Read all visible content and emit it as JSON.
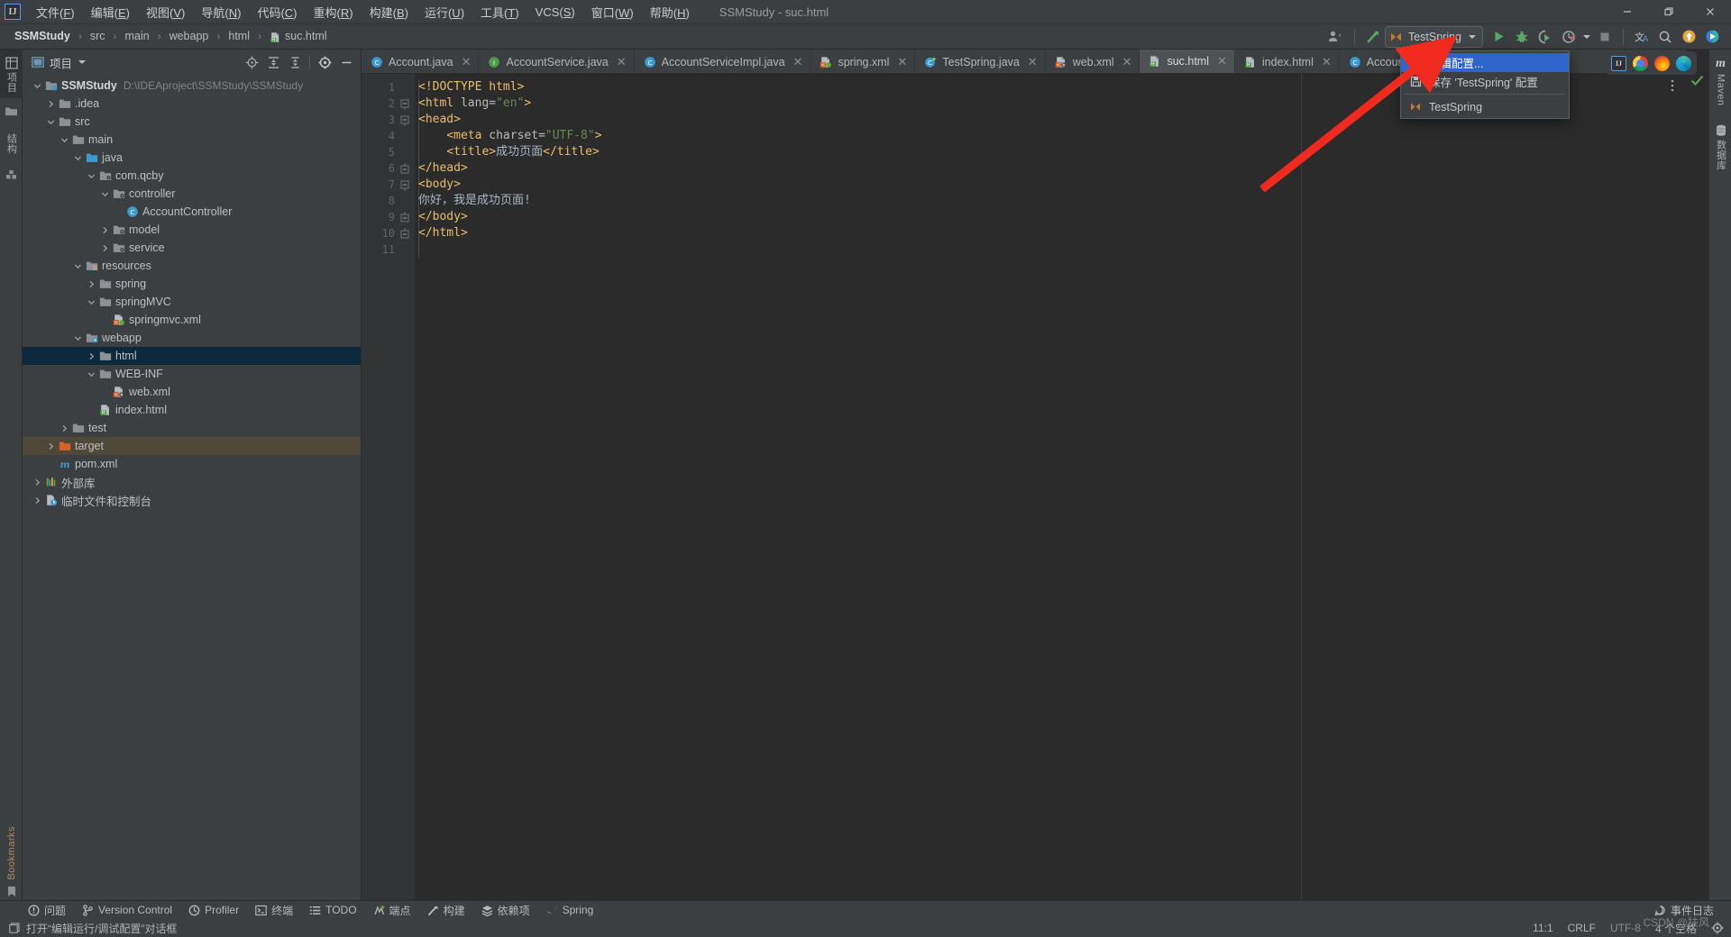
{
  "window": {
    "title": "SSMStudy - suc.html",
    "logo": "intellij-idea-logo",
    "minimize": "—",
    "restore": "❐",
    "close": "✕"
  },
  "menubar": [
    {
      "label": "文件(F)",
      "name": "menu-file"
    },
    {
      "label": "编辑(E)",
      "name": "menu-edit"
    },
    {
      "label": "视图(V)",
      "name": "menu-view"
    },
    {
      "label": "导航(N)",
      "name": "menu-navigate"
    },
    {
      "label": "代码(C)",
      "name": "menu-code"
    },
    {
      "label": "重构(R)",
      "name": "menu-refactor"
    },
    {
      "label": "构建(B)",
      "name": "menu-build"
    },
    {
      "label": "运行(U)",
      "name": "menu-run"
    },
    {
      "label": "工具(T)",
      "name": "menu-tools"
    },
    {
      "label": "VCS(S)",
      "name": "menu-vcs"
    },
    {
      "label": "窗口(W)",
      "name": "menu-window"
    },
    {
      "label": "帮助(H)",
      "name": "menu-help"
    }
  ],
  "breadcrumb": {
    "items": [
      "SSMStudy",
      "src",
      "main",
      "webapp",
      "html",
      "suc.html"
    ],
    "separator": "›"
  },
  "toolbar": {
    "run_config_name": "TestSpring",
    "run_label": "run-button",
    "debug_label": "debug-button",
    "coverage_label": "run-with-coverage-button",
    "profiler_label": "profiler-button",
    "stop_label": "stop-button",
    "translate_label": "translate-button",
    "search_label": "search-everywhere-button",
    "update_label": "update-project-button",
    "bigdata_label": "big-data-tools-button",
    "account_label": "account-button",
    "build_label": "build-button"
  },
  "dropdown": {
    "items": [
      {
        "label": "编辑配置...",
        "icon": "gear-icon",
        "selected": true
      },
      {
        "label": "保存 'TestSpring' 配置",
        "icon": "save-icon",
        "selected": false
      },
      {
        "label": "TestSpring",
        "icon": "run-config-icon",
        "selected": false
      }
    ]
  },
  "left_strip": {
    "top": [
      {
        "label": "项目",
        "name": "tool-window-project",
        "active": true
      },
      {
        "label": "",
        "name": "tool-window-commit",
        "active": false
      },
      {
        "label": "结构",
        "name": "tool-window-structure",
        "active": false
      },
      {
        "label": "",
        "name": "tool-window-services",
        "active": false
      }
    ],
    "bottom": [
      {
        "label": "Bookmarks",
        "name": "tool-window-bookmarks",
        "active": false
      }
    ]
  },
  "right_strip": {
    "items": [
      {
        "label": "Maven",
        "name": "tool-window-maven"
      },
      {
        "label": "数据库",
        "name": "tool-window-database"
      }
    ]
  },
  "project_panel": {
    "title": "项目",
    "icons": [
      "locate-icon",
      "expand-all-icon",
      "collapse-all-icon",
      "settings-icon",
      "hide-icon"
    ],
    "tree": [
      {
        "depth": 0,
        "arrow": "down",
        "icon": "module-folder",
        "label": "SSMStudy",
        "bold": true,
        "path": "D:\\IDEAproject\\SSMStudy\\SSMStudy",
        "state": "normal"
      },
      {
        "depth": 1,
        "arrow": "right",
        "icon": "folder",
        "label": ".idea",
        "bold": false,
        "path": "",
        "state": "normal"
      },
      {
        "depth": 1,
        "arrow": "down",
        "icon": "folder",
        "label": "src",
        "bold": false,
        "path": "",
        "state": "normal"
      },
      {
        "depth": 2,
        "arrow": "down",
        "icon": "folder",
        "label": "main",
        "bold": false,
        "path": "",
        "state": "normal"
      },
      {
        "depth": 3,
        "arrow": "down",
        "icon": "source-folder",
        "label": "java",
        "bold": false,
        "path": "",
        "state": "normal"
      },
      {
        "depth": 4,
        "arrow": "down",
        "icon": "package",
        "label": "com.qcby",
        "bold": false,
        "path": "",
        "state": "normal"
      },
      {
        "depth": 5,
        "arrow": "down",
        "icon": "package",
        "label": "controller",
        "bold": false,
        "path": "",
        "state": "normal"
      },
      {
        "depth": 6,
        "arrow": "none",
        "icon": "java-class",
        "label": "AccountController",
        "bold": false,
        "path": "",
        "state": "normal"
      },
      {
        "depth": 5,
        "arrow": "right",
        "icon": "package",
        "label": "model",
        "bold": false,
        "path": "",
        "state": "normal"
      },
      {
        "depth": 5,
        "arrow": "right",
        "icon": "package",
        "label": "service",
        "bold": false,
        "path": "",
        "state": "normal"
      },
      {
        "depth": 3,
        "arrow": "down",
        "icon": "resource-folder",
        "label": "resources",
        "bold": false,
        "path": "",
        "state": "normal"
      },
      {
        "depth": 4,
        "arrow": "right",
        "icon": "folder",
        "label": "spring",
        "bold": false,
        "path": "",
        "state": "normal"
      },
      {
        "depth": 4,
        "arrow": "down",
        "icon": "folder",
        "label": "springMVC",
        "bold": false,
        "path": "",
        "state": "normal"
      },
      {
        "depth": 5,
        "arrow": "none",
        "icon": "xml-spring",
        "label": "springmvc.xml",
        "bold": false,
        "path": "",
        "state": "normal"
      },
      {
        "depth": 3,
        "arrow": "down",
        "icon": "web-folder",
        "label": "webapp",
        "bold": false,
        "path": "",
        "state": "normal"
      },
      {
        "depth": 4,
        "arrow": "right",
        "icon": "folder",
        "label": "html",
        "bold": false,
        "path": "",
        "state": "selected"
      },
      {
        "depth": 4,
        "arrow": "down",
        "icon": "folder",
        "label": "WEB-INF",
        "bold": false,
        "path": "",
        "state": "normal"
      },
      {
        "depth": 5,
        "arrow": "none",
        "icon": "xml-web",
        "label": "web.xml",
        "bold": false,
        "path": "",
        "state": "normal"
      },
      {
        "depth": 4,
        "arrow": "none",
        "icon": "html-file",
        "label": "index.html",
        "bold": false,
        "path": "",
        "state": "normal"
      },
      {
        "depth": 2,
        "arrow": "right",
        "icon": "folder",
        "label": "test",
        "bold": false,
        "path": "",
        "state": "normal"
      },
      {
        "depth": 1,
        "arrow": "right",
        "icon": "excluded-folder",
        "label": "target",
        "bold": false,
        "path": "",
        "state": "excluded"
      },
      {
        "depth": 1,
        "arrow": "none",
        "icon": "maven-file",
        "label": "pom.xml",
        "bold": false,
        "path": "",
        "state": "normal"
      },
      {
        "depth": 0,
        "arrow": "right",
        "icon": "library",
        "label": "外部库",
        "bold": false,
        "path": "",
        "state": "normal"
      },
      {
        "depth": 0,
        "arrow": "right",
        "icon": "scratches",
        "label": "临时文件和控制台",
        "bold": false,
        "path": "",
        "state": "normal"
      }
    ]
  },
  "editor_tabs": [
    {
      "label": "Account.java",
      "icon": "java-class",
      "active": false
    },
    {
      "label": "AccountService.java",
      "icon": "java-interface",
      "active": false
    },
    {
      "label": "AccountServiceImpl.java",
      "icon": "java-class",
      "active": false
    },
    {
      "label": "spring.xml",
      "icon": "xml-spring",
      "active": false
    },
    {
      "label": "TestSpring.java",
      "icon": "java-test",
      "active": false
    },
    {
      "label": "web.xml",
      "icon": "xml-web",
      "active": false
    },
    {
      "label": "suc.html",
      "icon": "html-file",
      "active": true
    },
    {
      "label": "index.html",
      "icon": "html-file",
      "active": false
    },
    {
      "label": "AccountController",
      "icon": "java-class",
      "active": false
    }
  ],
  "editor": {
    "filename": "suc.html",
    "line_count": 11,
    "lines": [
      {
        "no": 1,
        "fold": "none",
        "segments": [
          {
            "t": "<!DOCTYPE html>",
            "c": "tk-doc"
          }
        ],
        "indent": ""
      },
      {
        "no": 2,
        "fold": "open",
        "segments": [
          {
            "t": "<html ",
            "c": "tk-tag"
          },
          {
            "t": "lang=",
            "c": "tk-attr"
          },
          {
            "t": "\"en\"",
            "c": "tk-str"
          },
          {
            "t": ">",
            "c": "tk-tag"
          }
        ],
        "indent": ""
      },
      {
        "no": 3,
        "fold": "open",
        "segments": [
          {
            "t": "<head>",
            "c": "tk-tag"
          }
        ],
        "indent": ""
      },
      {
        "no": 4,
        "fold": "none",
        "segments": [
          {
            "t": "<meta ",
            "c": "tk-tag"
          },
          {
            "t": "charset=",
            "c": "tk-attr"
          },
          {
            "t": "\"UTF-8\"",
            "c": "tk-str"
          },
          {
            "t": ">",
            "c": "tk-tag"
          }
        ],
        "indent": "    "
      },
      {
        "no": 5,
        "fold": "none",
        "segments": [
          {
            "t": "<title>",
            "c": "tk-tag"
          },
          {
            "t": "成功页面",
            "c": "tk-txt"
          },
          {
            "t": "</title>",
            "c": "tk-tag"
          }
        ],
        "indent": "    "
      },
      {
        "no": 6,
        "fold": "close",
        "segments": [
          {
            "t": "</head>",
            "c": "tk-tag"
          }
        ],
        "indent": ""
      },
      {
        "no": 7,
        "fold": "open",
        "segments": [
          {
            "t": "<body>",
            "c": "tk-tag"
          }
        ],
        "indent": ""
      },
      {
        "no": 8,
        "fold": "none",
        "segments": [
          {
            "t": "你好，我是成功页面!",
            "c": "tk-txt"
          }
        ],
        "indent": ""
      },
      {
        "no": 9,
        "fold": "close",
        "segments": [
          {
            "t": "</body>",
            "c": "tk-tag"
          }
        ],
        "indent": ""
      },
      {
        "no": 10,
        "fold": "close",
        "segments": [
          {
            "t": "</html>",
            "c": "tk-tag"
          }
        ],
        "indent": ""
      },
      {
        "no": 11,
        "fold": "none",
        "segments": [],
        "indent": ""
      }
    ],
    "browsers": [
      "intellij-browser-icon",
      "chrome-icon",
      "firefox-icon",
      "edge-icon"
    ]
  },
  "bottom_tools": [
    {
      "label": "问题",
      "icon": "problems-icon"
    },
    {
      "label": "Version Control",
      "icon": "version-control-icon"
    },
    {
      "label": "Profiler",
      "icon": "profiler-icon"
    },
    {
      "label": "终端",
      "icon": "terminal-icon"
    },
    {
      "label": "TODO",
      "icon": "todo-icon"
    },
    {
      "label": "端点",
      "icon": "endpoints-icon"
    },
    {
      "label": "构建",
      "icon": "build-icon"
    },
    {
      "label": "依赖项",
      "icon": "dependencies-icon"
    },
    {
      "label": "Spring",
      "icon": "spring-icon"
    }
  ],
  "bottom_right": {
    "event_log": "事件日志",
    "event_log_icon": "notification-icon"
  },
  "status_bar": {
    "message": "打开“编辑运行/调试配置”对话框",
    "message_icon": "dialog-icon",
    "caret_position": "11:1",
    "line_separator": "CRLF",
    "encoding": "UTF-8",
    "indent": "4 个空格",
    "lock_icon": "settings-icon"
  },
  "watermark": "CSDN @扶风",
  "colors": {
    "accent_blue": "#2f65ca",
    "panel_bg": "#3c3f41",
    "editor_bg": "#2b2b2b",
    "selection": "#0d293e",
    "excluded": "#4f4737",
    "arrow_red": "#f02a1e",
    "green": "#59a869",
    "orange": "#e8a33d"
  }
}
